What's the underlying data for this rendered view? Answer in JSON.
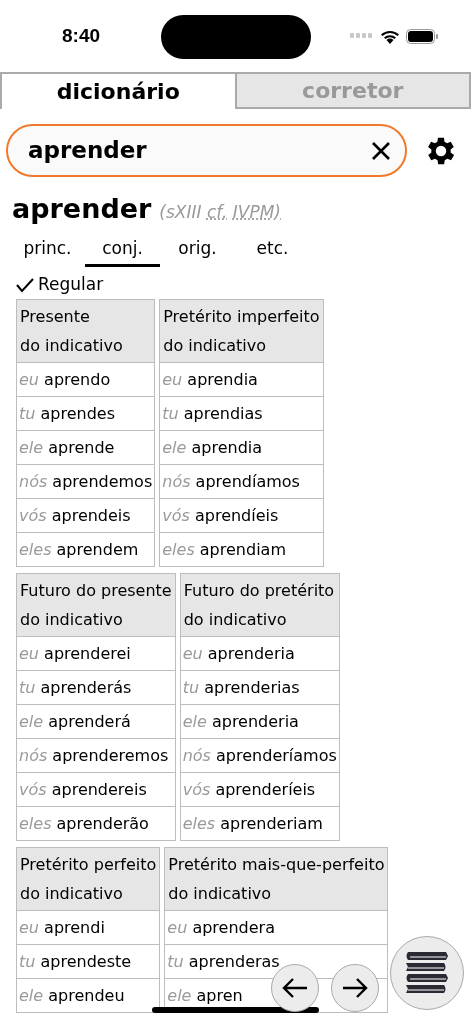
{
  "status_bar": {
    "time": "8:40"
  },
  "tabs": [
    {
      "label": "dicionário",
      "selected": true
    },
    {
      "label": "corretor",
      "selected": false
    }
  ],
  "search": {
    "value": "aprender"
  },
  "entry": {
    "headword": "aprender",
    "note": "(sXIII",
    "abbrevs": [
      "cf.",
      "IVPM)"
    ]
  },
  "sections": [
    {
      "label": "princ.",
      "selected": false
    },
    {
      "label": "conj.",
      "selected": true
    },
    {
      "label": "orig.",
      "selected": false
    },
    {
      "label": "etc.",
      "selected": false
    }
  ],
  "regular": {
    "label": "Regular",
    "checked": true
  },
  "groups": [
    {
      "tables": [
        {
          "title": [
            "Presente",
            "do indicativo"
          ],
          "rows": [
            [
              "eu",
              "aprendo"
            ],
            [
              "tu",
              "aprendes"
            ],
            [
              "ele",
              "aprende"
            ],
            [
              "nós",
              "aprendemos"
            ],
            [
              "vós",
              "aprendeis"
            ],
            [
              "eles",
              "aprendem"
            ]
          ]
        },
        {
          "title": [
            "Pretérito imperfeito",
            "do indicativo"
          ],
          "rows": [
            [
              "eu",
              "aprendia"
            ],
            [
              "tu",
              "aprendias"
            ],
            [
              "ele",
              "aprendia"
            ],
            [
              "nós",
              "aprendíamos"
            ],
            [
              "vós",
              "aprendíeis"
            ],
            [
              "eles",
              "aprendiam"
            ]
          ]
        }
      ]
    },
    {
      "tables": [
        {
          "title": [
            "Futuro do presente",
            "do indicativo"
          ],
          "rows": [
            [
              "eu",
              "aprenderei"
            ],
            [
              "tu",
              "aprenderás"
            ],
            [
              "ele",
              "aprenderá"
            ],
            [
              "nós",
              "aprenderemos"
            ],
            [
              "vós",
              "aprendereis"
            ],
            [
              "eles",
              "aprenderão"
            ]
          ]
        },
        {
          "title": [
            "Futuro do pretérito",
            "do indicativo"
          ],
          "rows": [
            [
              "eu",
              "aprenderia"
            ],
            [
              "tu",
              "aprenderias"
            ],
            [
              "ele",
              "aprenderia"
            ],
            [
              "nós",
              "aprenderíamos"
            ],
            [
              "vós",
              "aprenderíeis"
            ],
            [
              "eles",
              "aprenderiam"
            ]
          ]
        }
      ]
    },
    {
      "tables": [
        {
          "title": [
            "Pretérito perfeito",
            "do indicativo"
          ],
          "rows": [
            [
              "eu",
              "aprendi"
            ],
            [
              "tu",
              "aprendeste"
            ],
            [
              "ele",
              "aprendeu"
            ]
          ]
        },
        {
          "title": [
            "Pretérito mais-que-perfeito",
            "do indicativo"
          ],
          "rows": [
            [
              "eu",
              "aprendera"
            ],
            [
              "tu",
              "aprenderas"
            ],
            [
              "ele",
              "apren"
            ]
          ]
        }
      ]
    }
  ]
}
